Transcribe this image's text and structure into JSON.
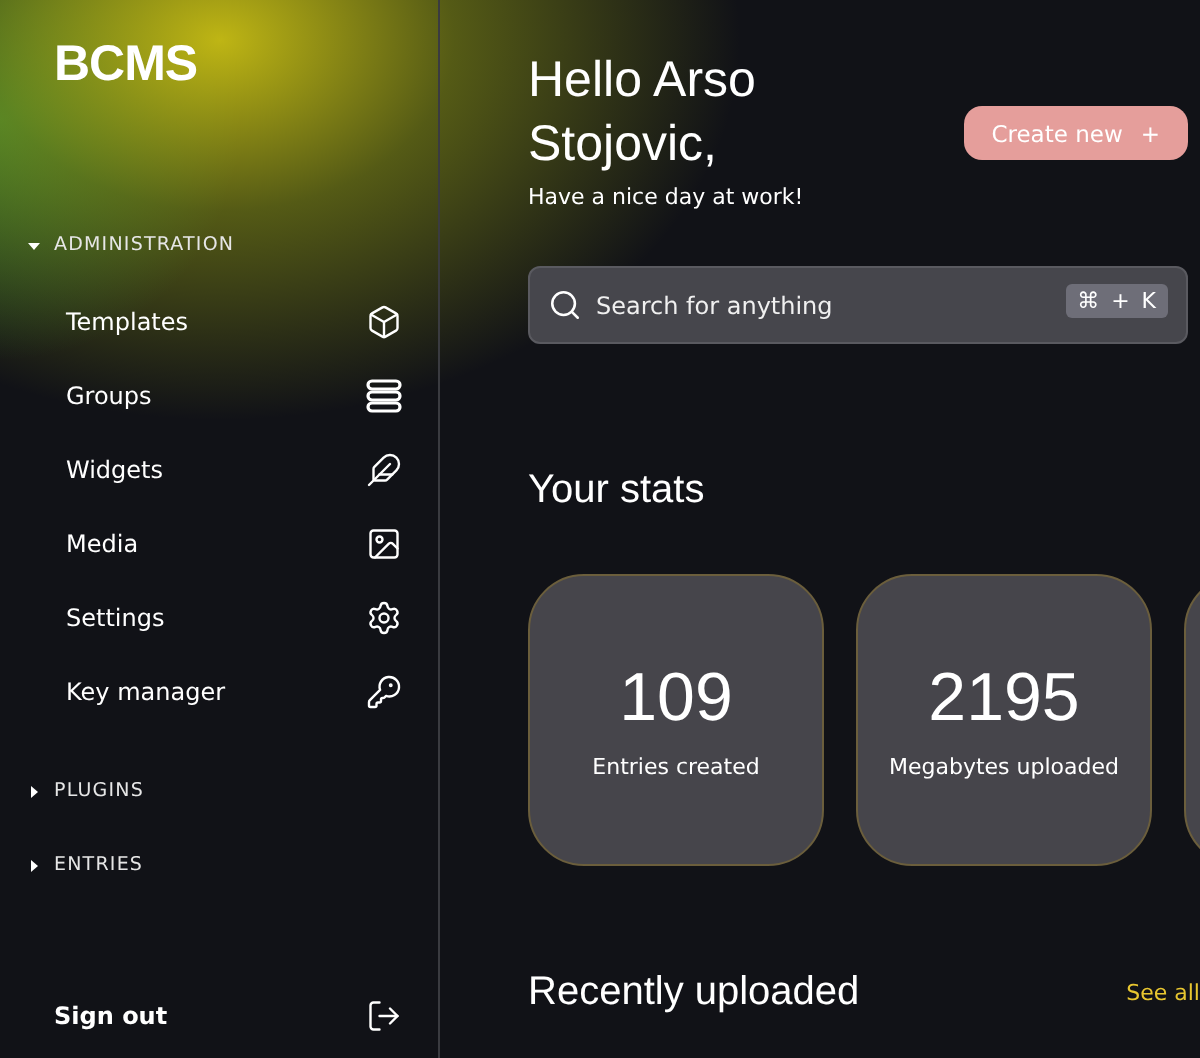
{
  "logo": "BCMS",
  "sidebar": {
    "sections": [
      {
        "label": "ADMINISTRATION",
        "expanded": true,
        "items": [
          {
            "label": "Templates",
            "kind": "cube"
          },
          {
            "label": "Groups",
            "kind": "stack"
          },
          {
            "label": "Widgets",
            "kind": "feather"
          },
          {
            "label": "Media",
            "kind": "image"
          },
          {
            "label": "Settings",
            "kind": "gear"
          },
          {
            "label": "Key manager",
            "kind": "key"
          }
        ]
      },
      {
        "label": "PLUGINS",
        "expanded": false
      },
      {
        "label": "ENTRIES",
        "expanded": false
      }
    ],
    "sign_out": "Sign out"
  },
  "greeting": {
    "title": "Hello Arso Stojovic,",
    "subtitle": "Have a nice day at work!"
  },
  "create_button": {
    "label": "Create new",
    "icon": "+"
  },
  "search": {
    "placeholder": "Search for anything",
    "shortcut": [
      "⌘",
      "+",
      "K"
    ]
  },
  "stats": {
    "title": "Your stats",
    "cards": [
      {
        "value": "109",
        "label": "Entries created"
      },
      {
        "value": "2195",
        "label": "Megabytes uploaded"
      }
    ]
  },
  "recent": {
    "title": "Recently uploaded",
    "link": "See all"
  }
}
